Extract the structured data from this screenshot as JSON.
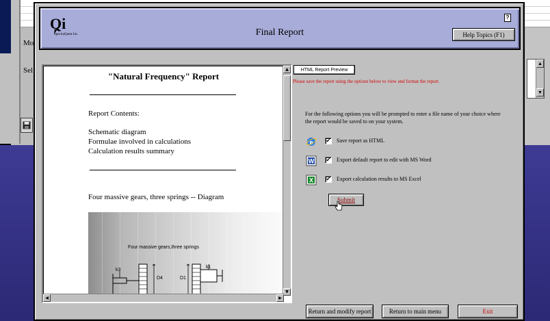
{
  "background": {
    "label_1": "Mo",
    "label_2": "Sel"
  },
  "header": {
    "logo_mark": "Qi",
    "logo_sub": "SpectraQuest Inc.",
    "title": "Final Report",
    "help_icon": "?",
    "help_button": "Help Topics (F1)"
  },
  "report": {
    "title": "\"Natural Frequency\" Report",
    "contents_heading": "Report Contents:",
    "contents_items": [
      "Schematic diagram",
      "Formulae involved in calculations",
      "Calculation results summary"
    ],
    "diagram_heading": "Four massive gears, three springs -- Diagram",
    "diagram_caption": "Four massive gears,three springs",
    "diagram_labels": {
      "k3": "k3",
      "d4": "D4",
      "d1": "D1",
      "k1": "k1"
    }
  },
  "panel": {
    "tab_label": "HTML Report Preview",
    "warning": "Please save the report using the options below to view and format the report.",
    "info": "For the following options you will be prompted to enter a file name of your choice where the report would be saved to on your system.",
    "options": [
      {
        "label": "Save report as HTML",
        "checked": true,
        "icon": "internet-explorer-icon"
      },
      {
        "label": "Export default report to edit with MS Word",
        "checked": true,
        "icon": "word-icon"
      },
      {
        "label": "Export calculation results to MS Excel",
        "checked": true,
        "icon": "excel-icon"
      }
    ],
    "submit": "Submit"
  },
  "footer": {
    "return_modify": "Return and modify report",
    "return_main": "Return to main menu",
    "exit": "Exit"
  },
  "colors": {
    "header_bg": "#a8acd8",
    "dialog_bg": "#c0c0c0",
    "warning": "#d40000",
    "exit_text": "#c80000"
  }
}
